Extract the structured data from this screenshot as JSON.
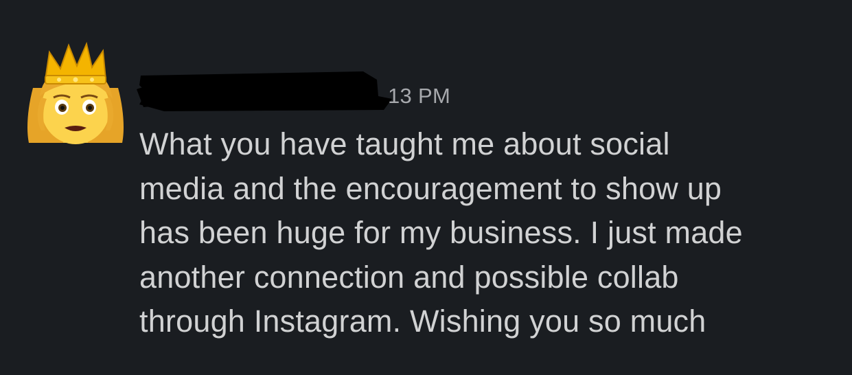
{
  "message": {
    "sender_name": "",
    "timestamp": "13 PM",
    "avatar_icon": "princess-emoji-icon",
    "text_lines": [
      "What you have taught me about social",
      "media and the encouragement to show up",
      "has been huge for my business. I just made",
      "another connection and possible collab",
      "through Instagram. Wishing you so much"
    ]
  },
  "colors": {
    "background": "#1a1d21",
    "text": "#d1d2d3",
    "timestamp": "#a7a9ad",
    "redaction": "#000000"
  }
}
